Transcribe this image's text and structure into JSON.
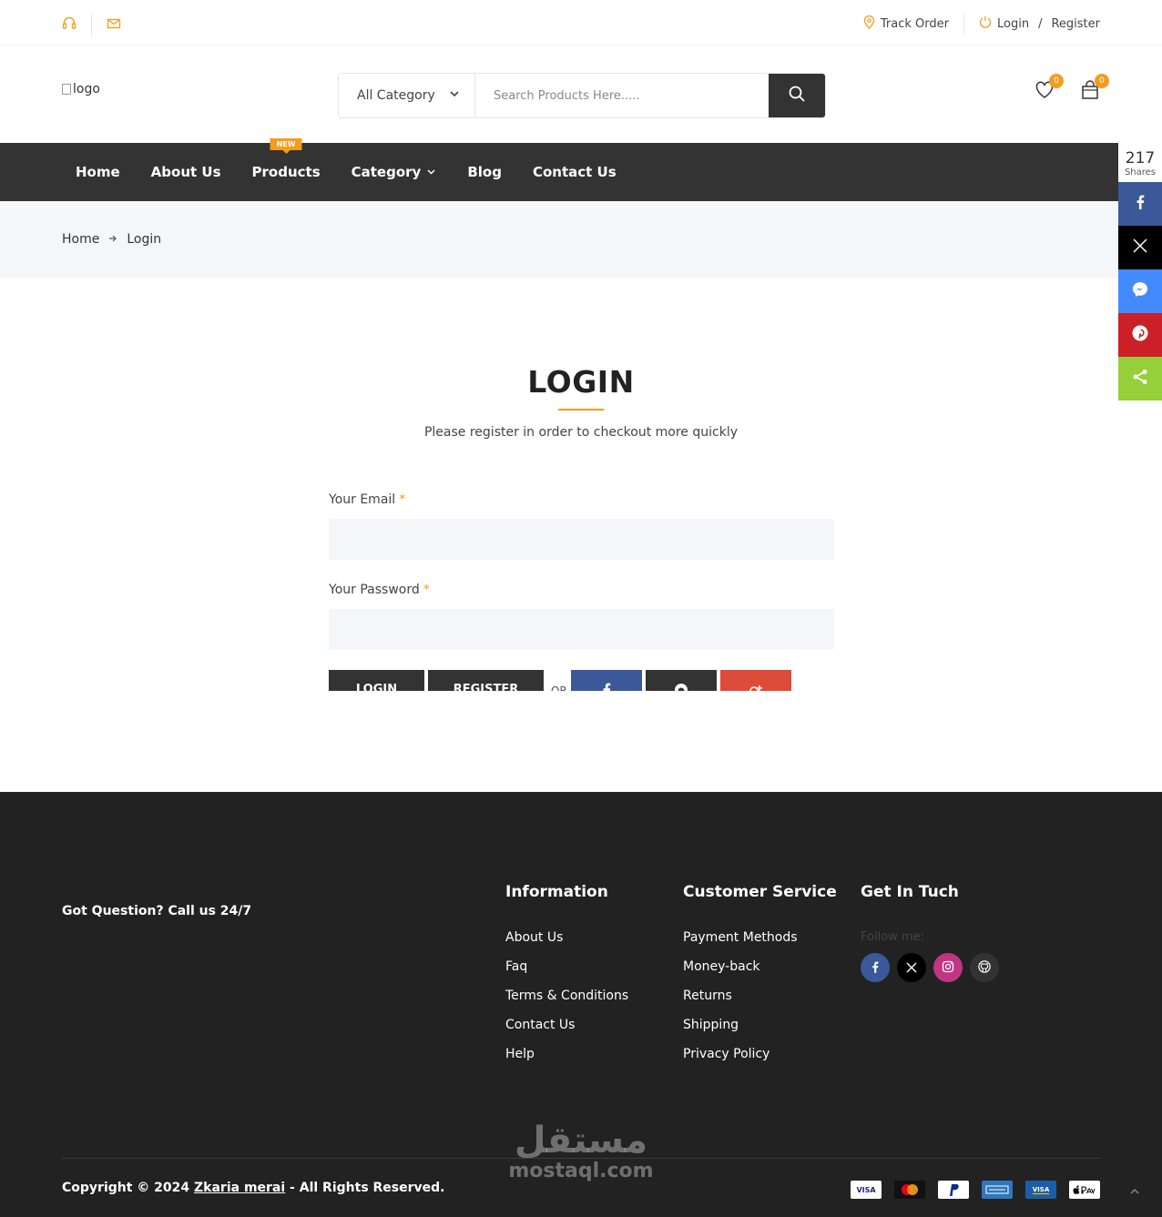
{
  "topbar": {
    "track_order": "Track Order",
    "login": "Login",
    "slash": "/",
    "register": "Register"
  },
  "header": {
    "logo_alt": "logo",
    "category": "All Category",
    "search_placeholder": "Search Products Here.....",
    "wishlist_count": "0",
    "cart_count": "0"
  },
  "nav": {
    "items": [
      {
        "label": "Home"
      },
      {
        "label": "About Us"
      },
      {
        "label": "Products",
        "tag": "NEW"
      },
      {
        "label": "Category"
      },
      {
        "label": "Blog"
      },
      {
        "label": "Contact Us"
      }
    ]
  },
  "breadcrumb": {
    "home": "Home",
    "current": "Login"
  },
  "share": {
    "count": "217",
    "label": "Shares",
    "colors": {
      "facebook": "#3b5998",
      "x": "#000000",
      "messenger": "#448aff",
      "pinterest": "#cb2027",
      "sharethis": "#95d03a"
    }
  },
  "login": {
    "title": "LOGIN",
    "subtitle": "Please register in order to checkout more quickly",
    "email_label": "Your Email",
    "password_label": "Your Password",
    "required_mark": "*",
    "login_btn": "LOGIN",
    "register_btn": "REGISTER",
    "or": "OR"
  },
  "footer": {
    "call": "Got Question? Call us 24/7",
    "information": {
      "title": "Information",
      "links": [
        "About Us",
        "Faq",
        "Terms & Conditions",
        "Contact Us",
        "Help"
      ]
    },
    "customer_service": {
      "title": "Customer Service",
      "links": [
        "Payment Methods",
        "Money-back",
        "Returns",
        "Shipping",
        "Privacy Policy"
      ]
    },
    "get_in_touch": {
      "title": "Get In Tuch",
      "follow": "Follow me:"
    },
    "copyright_prefix": "Copyright © 2024 ",
    "copyright_name": "Zkaria merai",
    "copyright_suffix": " - All Rights Reserved.",
    "watermark_ar": "مستقل",
    "watermark_lat": "mostaql.com"
  },
  "theme": {
    "accent": "#f39c1f",
    "dark": "#333333",
    "footer_bg": "#222222",
    "light_bg": "#f5f6fa"
  }
}
